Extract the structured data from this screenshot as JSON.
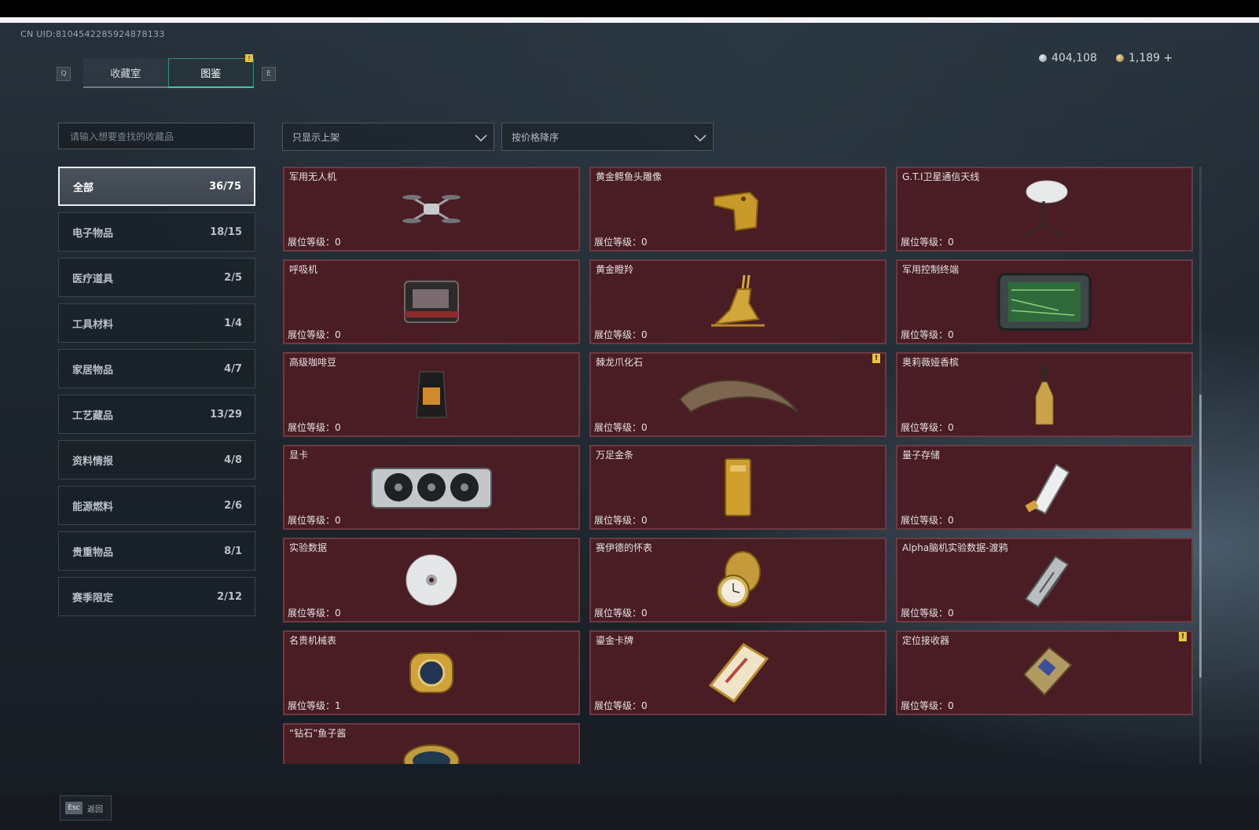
{
  "header": {
    "uid": "CN UID:8104542285924878133",
    "key_left": "Q",
    "key_right": "E",
    "tabs": [
      {
        "label": "收藏室"
      },
      {
        "label": "图鉴"
      }
    ],
    "tab_badge": "!",
    "currency_1": "404,108",
    "currency_2": "1,189 +"
  },
  "search": {
    "placeholder": "请输入想要查找的收藏品"
  },
  "filters": {
    "filter_1": "只显示上架",
    "filter_2": "按价格降序"
  },
  "categories": [
    {
      "label": "全部",
      "count": "36/75"
    },
    {
      "label": "电子物品",
      "count": "18/15"
    },
    {
      "label": "医疗道具",
      "count": "2/5"
    },
    {
      "label": "工具材料",
      "count": "1/4"
    },
    {
      "label": "家居物品",
      "count": "4/7"
    },
    {
      "label": "工艺藏品",
      "count": "13/29"
    },
    {
      "label": "资料情报",
      "count": "4/8"
    },
    {
      "label": "能源燃料",
      "count": "2/6"
    },
    {
      "label": "贵重物品",
      "count": "8/1"
    },
    {
      "label": "赛季限定",
      "count": "2/12"
    }
  ],
  "level_prefix": "展位等级：",
  "items": [
    {
      "name": "军用无人机",
      "level": "0",
      "icon": "drone-icon"
    },
    {
      "name": "黄金鳄鱼头雕像",
      "level": "0",
      "icon": "crocodile-head-icon"
    },
    {
      "name": "G.T.I卫星通信天线",
      "level": "0",
      "icon": "satellite-dish-icon"
    },
    {
      "name": "呼吸机",
      "level": "0",
      "icon": "ventilator-icon"
    },
    {
      "name": "黄金瞪羚",
      "level": "0",
      "icon": "gazelle-icon"
    },
    {
      "name": "军用控制终端",
      "level": "0",
      "icon": "terminal-icon"
    },
    {
      "name": "高级咖啡豆",
      "level": "0",
      "icon": "coffee-bag-icon"
    },
    {
      "name": "棘龙爪化石",
      "level": "0",
      "icon": "claw-fossil-icon",
      "warn": "!"
    },
    {
      "name": "奥莉薇娅香槟",
      "level": "0",
      "icon": "champagne-icon"
    },
    {
      "name": "显卡",
      "level": "0",
      "icon": "gpu-icon"
    },
    {
      "name": "万足金条",
      "level": "0",
      "icon": "gold-bar-icon"
    },
    {
      "name": "量子存储",
      "level": "0",
      "icon": "quantum-storage-icon"
    },
    {
      "name": "实验数据",
      "level": "0",
      "icon": "disc-icon"
    },
    {
      "name": "赛伊德的怀表",
      "level": "0",
      "icon": "pocket-watch-icon"
    },
    {
      "name": "Alpha脑机实验数据-渡鸦",
      "level": "0",
      "icon": "data-device-icon"
    },
    {
      "name": "名贵机械表",
      "level": "1",
      "icon": "wristwatch-icon"
    },
    {
      "name": "鎏金卡牌",
      "level": "0",
      "icon": "gilded-card-icon"
    },
    {
      "name": "定位接收器",
      "level": "0",
      "icon": "receiver-icon",
      "warn": "!"
    },
    {
      "name": "“钻石”鱼子酱",
      "level": "",
      "icon": "caviar-tin-icon"
    }
  ],
  "footer": {
    "key": "Esc",
    "label": "返回"
  }
}
